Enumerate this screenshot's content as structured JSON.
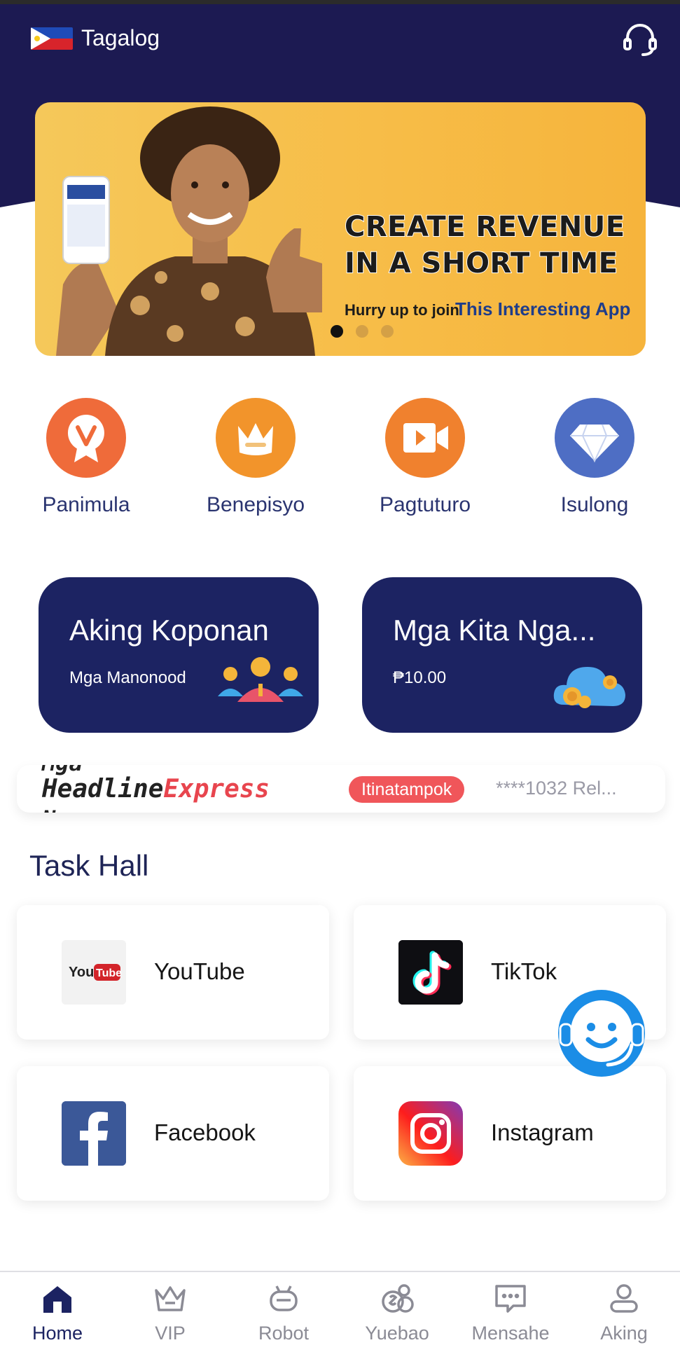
{
  "header": {
    "language_label": "Tagalog",
    "flag_icon": "philippines-flag-icon",
    "support_icon": "headset-icon"
  },
  "banner": {
    "headline_line1": "CREATE REVENUE",
    "headline_line2": "IN A SHORT TIME",
    "sub_text": "Hurry up to join",
    "sub_highlight": "This Interesting App",
    "slide_count": 3,
    "active_slide": 1
  },
  "quick_nav": [
    {
      "label": "Panimula",
      "icon": "v-badge-icon",
      "color": "#ef6b3a"
    },
    {
      "label": "Benepisyo",
      "icon": "crown-icon",
      "color": "#f2942b"
    },
    {
      "label": "Pagtuturo",
      "icon": "video-camera-icon",
      "color": "#f0812e"
    },
    {
      "label": "Isulong",
      "icon": "diamond-icon",
      "color": "#4e6ec4"
    }
  ],
  "cards": [
    {
      "title": "Aking Koponan",
      "subtitle": "Mga Manonood",
      "icon": "team-people-icon"
    },
    {
      "title": "Mga Kita Nga...",
      "subtitle": "₱10.00",
      "icon": "coin-cloud-icon"
    }
  ],
  "headline": {
    "logo_part1": "Headline",
    "logo_part2": "Express",
    "ghost_top": "Mga",
    "ghost_bottom": "N",
    "badge": "Itinatampok",
    "ticker": "****1032 Rel..."
  },
  "task_hall": {
    "title": "Task Hall",
    "items": [
      {
        "label": "YouTube",
        "icon": "youtube-icon"
      },
      {
        "label": "TikTok",
        "icon": "tiktok-icon"
      },
      {
        "label": "Facebook",
        "icon": "facebook-icon"
      },
      {
        "label": "Instagram",
        "icon": "instagram-icon"
      }
    ]
  },
  "floating_support_icon": "customer-service-agent-icon",
  "tabbar": [
    {
      "label": "Home",
      "icon": "home-icon",
      "active": true
    },
    {
      "label": "VIP",
      "icon": "vip-crown-icon",
      "active": false
    },
    {
      "label": "Robot",
      "icon": "robot-icon",
      "active": false
    },
    {
      "label": "Yuebao",
      "icon": "coins-icon",
      "active": false
    },
    {
      "label": "Mensahe",
      "icon": "message-icon",
      "active": false
    },
    {
      "label": "Aking",
      "icon": "user-icon",
      "active": false
    }
  ],
  "colors": {
    "navy": "#1c2362",
    "header_navy": "#1c1a52",
    "banner_yellow": "#f7bd48",
    "badge_red": "#f0565a"
  }
}
